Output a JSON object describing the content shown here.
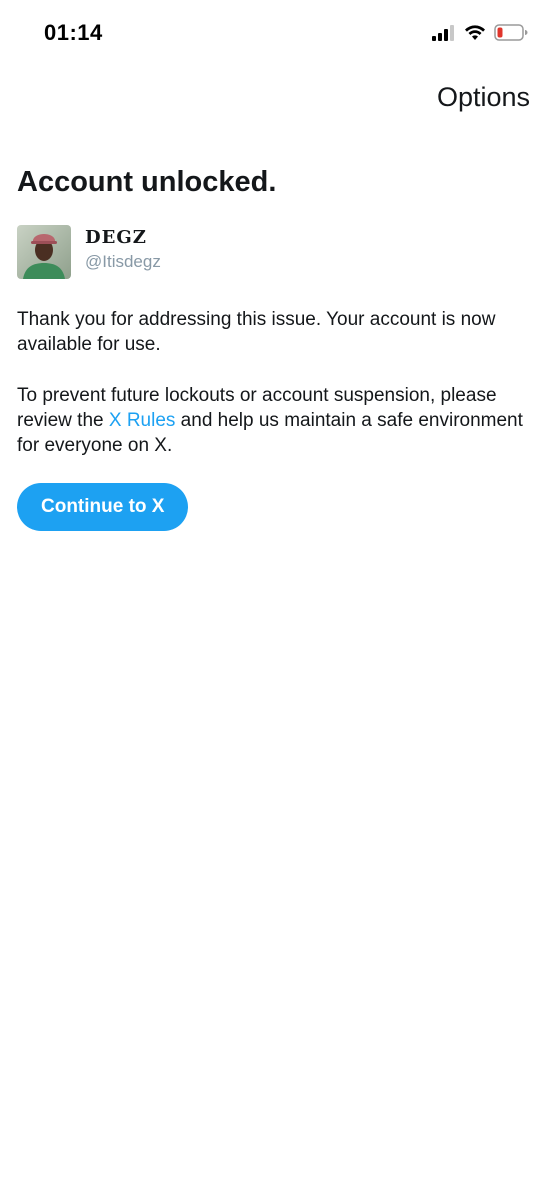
{
  "status_bar": {
    "time": "01:14",
    "icons": [
      "signal-icon",
      "wifi-icon",
      "battery-icon"
    ],
    "battery_color": "#e0352b"
  },
  "nav": {
    "options_label": "Options"
  },
  "page": {
    "title": "Account unlocked."
  },
  "user": {
    "display_name": "DEGZ",
    "handle": "@Itisdegz"
  },
  "body": {
    "paragraph1": "Thank you for addressing this issue. Your account is now available for use.",
    "paragraph2_before": "To prevent future lockouts or account suspension, please review the ",
    "paragraph2_link": "X Rules",
    "paragraph2_after": " and help us maintain a safe environment for everyone on X."
  },
  "actions": {
    "continue_label": "Continue to X"
  },
  "colors": {
    "accent": "#1da1f2",
    "text": "#14171a",
    "muted": "#8899a6"
  }
}
